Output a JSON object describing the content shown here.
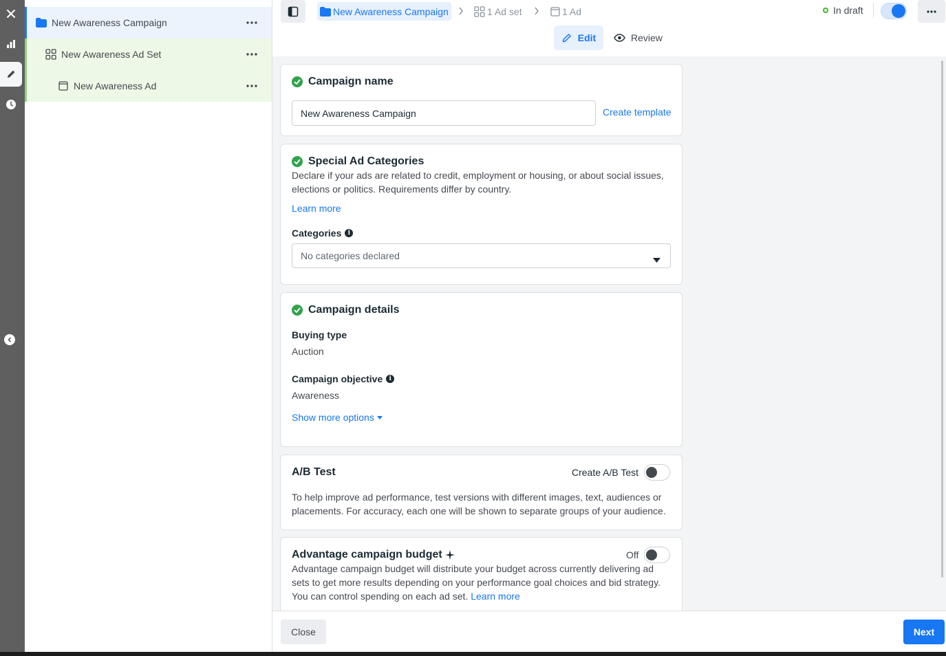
{
  "tree": {
    "campaign": "New Awareness Campaign",
    "ad_set": "New Awareness Ad Set",
    "ad": "New Awareness Ad"
  },
  "topbar": {
    "breadcrumb_campaign": "New Awareness Campaign",
    "breadcrumb_adset": "1 Ad set",
    "breadcrumb_ad": "1 Ad",
    "status": "In draft",
    "edit_label": "Edit",
    "review_label": "Review"
  },
  "campaign_name": {
    "title": "Campaign name",
    "value": "New Awareness Campaign",
    "create_template": "Create template"
  },
  "special_ad": {
    "title": "Special Ad Categories",
    "description": "Declare if your ads are related to credit, employment or housing, or about social issues, elections or politics. Requirements differ by country.",
    "learn_more": "Learn more",
    "categories_label": "Categories",
    "categories_placeholder": "No categories declared"
  },
  "campaign_details": {
    "title": "Campaign details",
    "buying_type_label": "Buying type",
    "buying_type_value": "Auction",
    "objective_label": "Campaign objective",
    "objective_value": "Awareness",
    "show_more": "Show more options"
  },
  "ab_test": {
    "title": "A/B Test",
    "toggle_label": "Create A/B Test",
    "description": "To help improve ad performance, test versions with different images, text, audiences or placements. For accuracy, each one will be shown to separate groups of your audience."
  },
  "budget": {
    "title": "Advantage campaign budget",
    "toggle_label": "Off",
    "description": "Advantage campaign budget will distribute your budget across currently delivering ad sets to get more results depending on your performance goal choices and bid strategy. You can control spending on each ad set.",
    "learn_more": "Learn more"
  },
  "footer": {
    "close_label": "Close",
    "next_label": "Next"
  },
  "colors": {
    "accent": "#1877f2",
    "success": "#31a24c"
  }
}
